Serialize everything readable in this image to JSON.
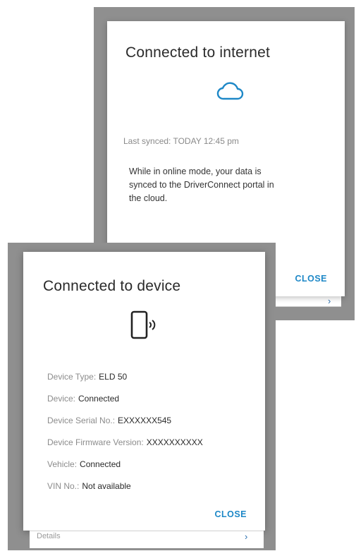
{
  "internet_dialog": {
    "title": "Connected to internet",
    "icon": "cloud-icon",
    "last_synced": "Last synced: TODAY 12:45 pm",
    "description": "While in online mode, your data is synced to the DriverConnect portal in the cloud.",
    "close_label": "CLOSE"
  },
  "device_dialog": {
    "title": "Connected to device",
    "icon": "phone-signal-icon",
    "details": [
      {
        "label": "Device Type:",
        "value": "ELD 50"
      },
      {
        "label": "Device:",
        "value": "Connected"
      },
      {
        "label": "Device Serial No.:",
        "value": "EXXXXXX545"
      },
      {
        "label": "Device Firmware Version:",
        "value": "XXXXXXXXXX"
      },
      {
        "label": "Vehicle:",
        "value": "Connected"
      },
      {
        "label": "VIN No.:",
        "value": "Not available"
      }
    ],
    "close_label": "CLOSE"
  },
  "background": {
    "details_label": "Details"
  },
  "colors": {
    "accent": "#1e88c7",
    "overlay": "#8f8f8f",
    "chevron": "#2a6fb0"
  }
}
